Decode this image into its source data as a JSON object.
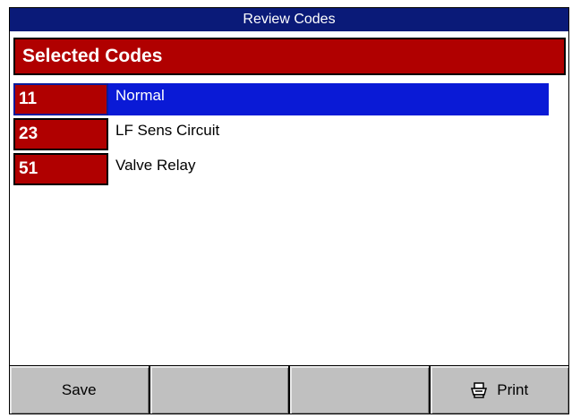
{
  "window": {
    "title": "Review Codes"
  },
  "section": {
    "header": "Selected Codes"
  },
  "codes": [
    {
      "code": "11",
      "description": "Normal",
      "selected": true
    },
    {
      "code": "23",
      "description": "LF Sens Circuit",
      "selected": false
    },
    {
      "code": "51",
      "description": "Valve Relay",
      "selected": false
    }
  ],
  "footer": {
    "buttons": [
      {
        "label": "Save",
        "icon": ""
      },
      {
        "label": "",
        "icon": ""
      },
      {
        "label": "",
        "icon": ""
      },
      {
        "label": "Print",
        "icon": "printer-icon"
      }
    ]
  },
  "colors": {
    "titlebar": "#0a1a78",
    "code_red": "#b00000",
    "selection_blue": "#0a1ad6",
    "footer_gray": "#c0c0c0"
  }
}
